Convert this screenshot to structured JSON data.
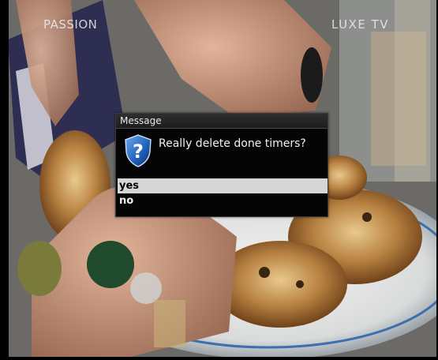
{
  "channel": {
    "left": "PASSION",
    "right": "LUXE TV"
  },
  "dialog": {
    "title": "Message",
    "text": "Really delete done timers?",
    "icon": "question-shield-icon",
    "options": [
      {
        "label": "yes",
        "selected": true
      },
      {
        "label": "no",
        "selected": false
      }
    ]
  },
  "colors": {
    "selection": "#d6d6d6",
    "dialog_bg": "#050505",
    "icon_blue": "#1e5fb8"
  }
}
